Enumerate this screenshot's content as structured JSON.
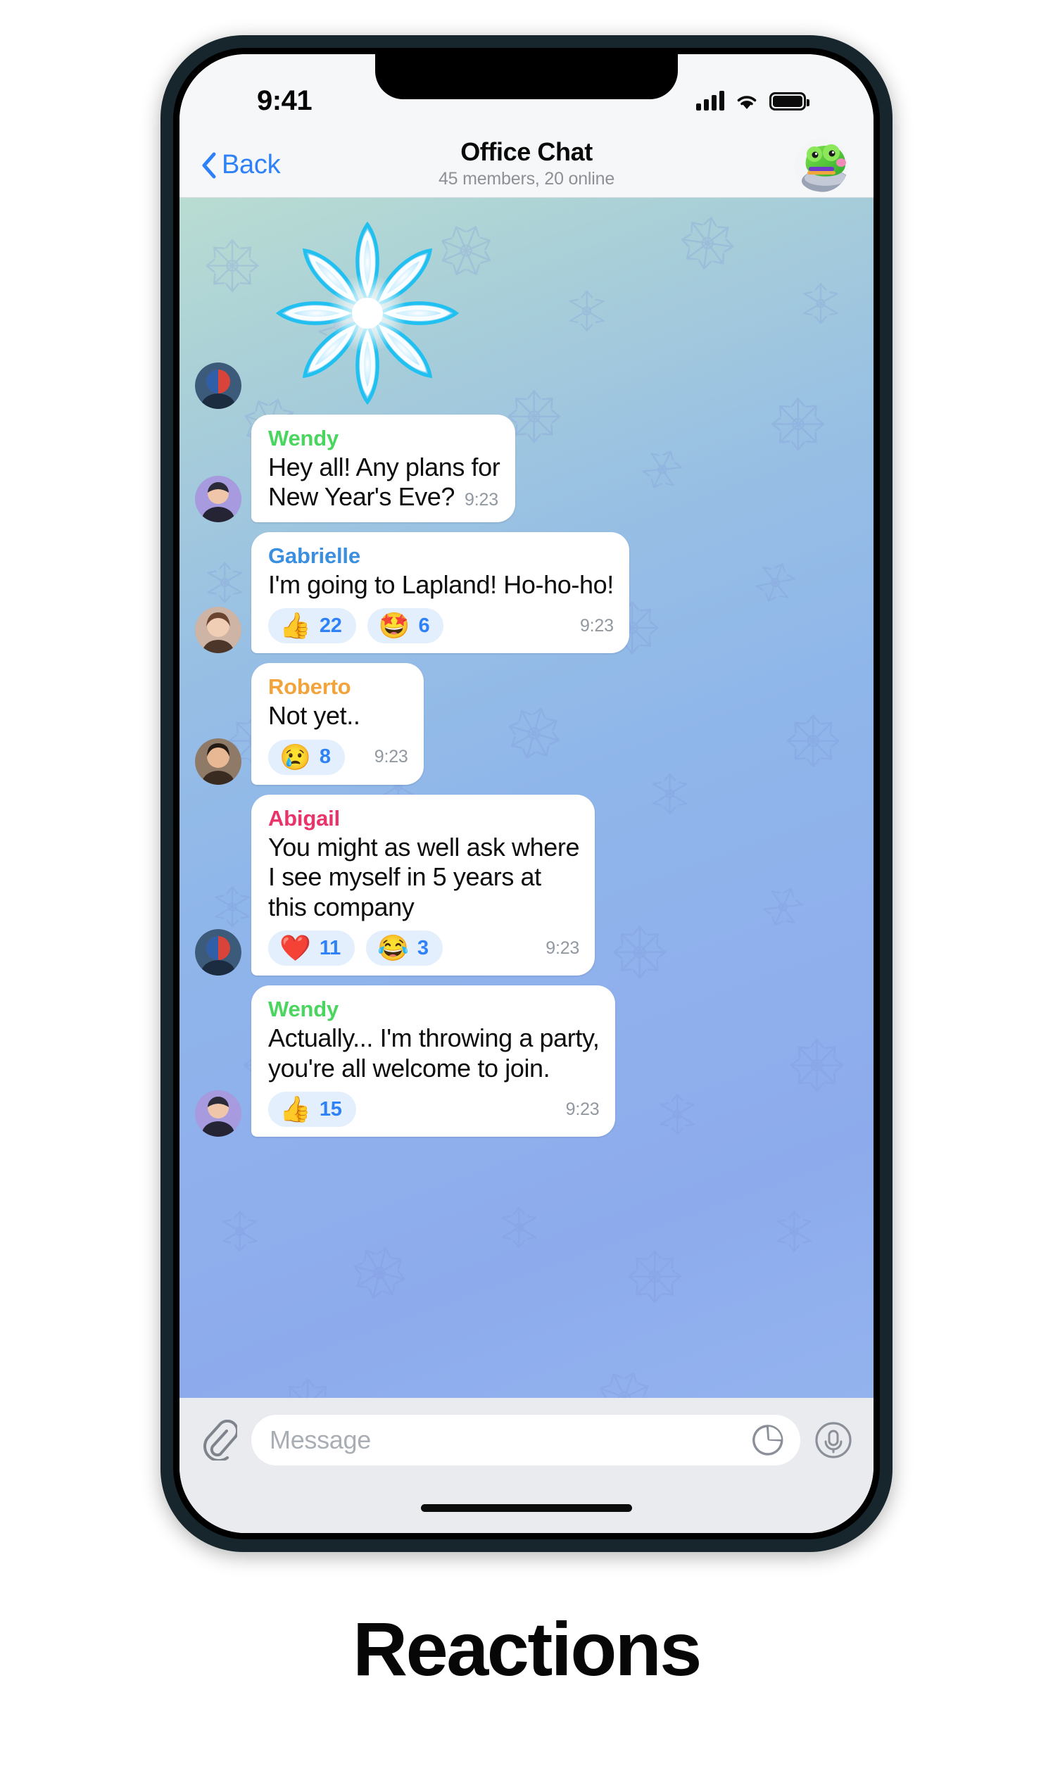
{
  "caption": "Reactions",
  "status_bar": {
    "time": "9:41",
    "icons": [
      "cellular-signal-icon",
      "wifi-icon",
      "battery-icon"
    ]
  },
  "navbar": {
    "back_label": "Back",
    "back_icon": "chevron-left-icon",
    "title": "Office Chat",
    "subtitle": "45 members, 20 online",
    "avatar": "group-avatar-frog"
  },
  "chat": {
    "sticker": {
      "name": "snowflake-sticker",
      "avatar": "avatar-abigail"
    },
    "messages": [
      {
        "sender": "Wendy",
        "sender_color": "#4ad65e",
        "text": "Hey all! Any plans for\nNew Year's Eve?",
        "time": "9:23",
        "avatar": "avatar-wendy",
        "reactions": []
      },
      {
        "sender": "Gabrielle",
        "sender_color": "#3b8fe0",
        "text": "I'm going to Lapland! Ho-ho-ho!",
        "time": "9:23",
        "avatar": "avatar-gabrielle",
        "reactions": [
          {
            "emoji": "👍",
            "name": "thumbs-up-reaction",
            "count": "22"
          },
          {
            "emoji": "🤩",
            "name": "star-struck-reaction",
            "count": "6"
          }
        ]
      },
      {
        "sender": "Roberto",
        "sender_color": "#f2a33c",
        "text": "Not yet..",
        "time": "9:23",
        "avatar": "avatar-roberto",
        "reactions": [
          {
            "emoji": "😢",
            "name": "crying-face-reaction",
            "count": "8"
          }
        ]
      },
      {
        "sender": "Abigail",
        "sender_color": "#e8346b",
        "text": "You might as well ask where\nI see myself in 5 years at\nthis company",
        "time": "9:23",
        "avatar": "avatar-abigail",
        "reactions": [
          {
            "emoji": "❤️",
            "name": "red-heart-reaction",
            "count": "11"
          },
          {
            "emoji": "😂",
            "name": "joy-face-reaction",
            "count": "3"
          }
        ]
      },
      {
        "sender": "Wendy",
        "sender_color": "#4ad65e",
        "text": "Actually... I'm throwing a party,\nyou're all welcome to join.",
        "time": "9:23",
        "avatar": "avatar-wendy",
        "reactions": [
          {
            "emoji": "👍",
            "name": "thumbs-up-reaction",
            "count": "15"
          }
        ]
      }
    ]
  },
  "composer": {
    "attach_icon": "paperclip-icon",
    "placeholder": "Message",
    "value": "",
    "sticker_icon": "sticker-icon",
    "mic_icon": "microphone-icon"
  },
  "colors": {
    "accent": "#2f81f7",
    "reaction_pill": "#e3effc",
    "bubble": "#ffffff"
  }
}
